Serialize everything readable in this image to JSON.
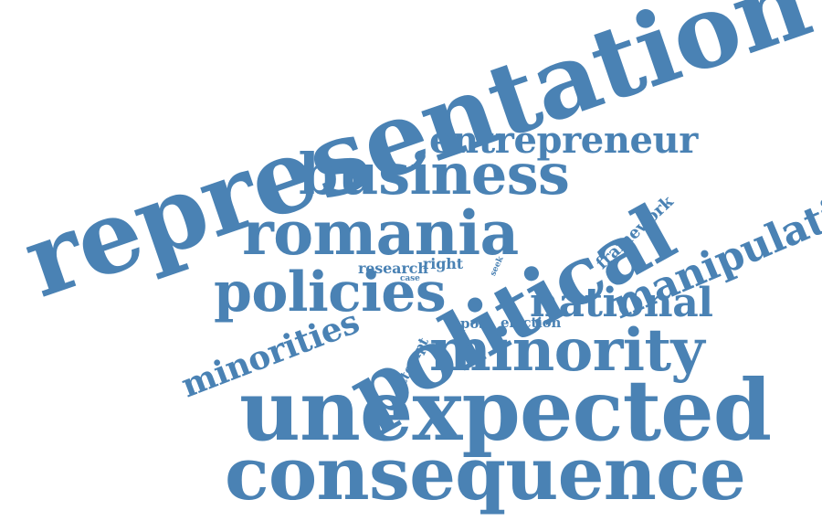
{
  "cloud": {
    "color": "#4a82b4",
    "words": [
      "representation",
      "entrepreneur",
      "business",
      "romania",
      "framework",
      "manipulation",
      "policies",
      "research",
      "right",
      "case",
      "seek",
      "political",
      "national",
      "minorities",
      "post",
      "election",
      "minority",
      "attempt",
      "unexpected",
      "consequence"
    ]
  }
}
